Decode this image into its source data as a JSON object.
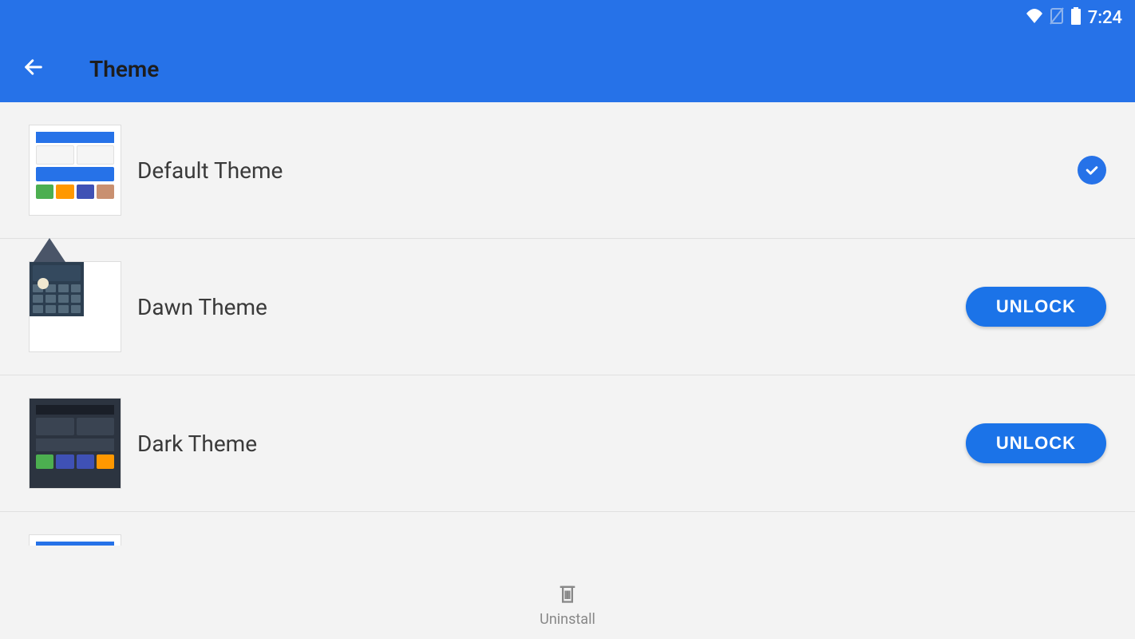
{
  "statusBar": {
    "time": "7:24"
  },
  "appBar": {
    "title": "Theme"
  },
  "themes": [
    {
      "name": "Default Theme",
      "selected": true,
      "unlockable": false
    },
    {
      "name": "Dawn Theme",
      "selected": false,
      "unlockable": true,
      "action": "UNLOCK"
    },
    {
      "name": "Dark Theme",
      "selected": false,
      "unlockable": true,
      "action": "UNLOCK"
    }
  ],
  "bottomBar": {
    "uninstall": "Uninstall"
  }
}
